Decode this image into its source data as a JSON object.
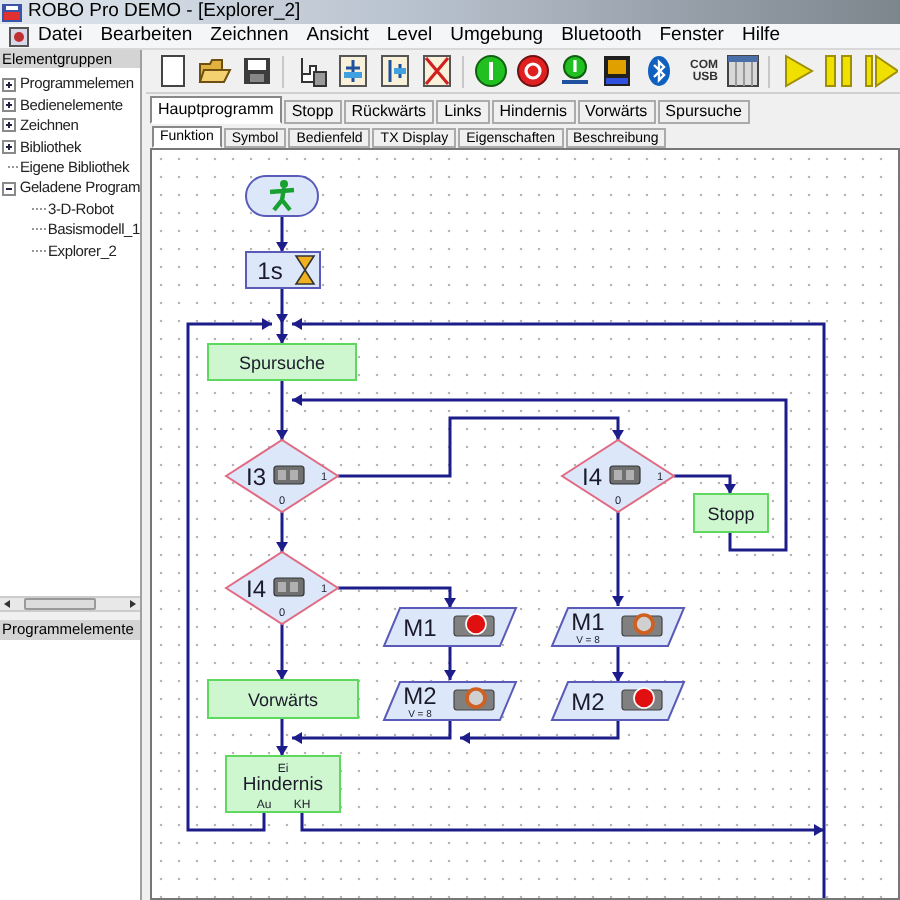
{
  "window": {
    "title": "ROBO Pro DEMO - [Explorer_2]"
  },
  "menu": [
    "Datei",
    "Bearbeiten",
    "Zeichnen",
    "Ansicht",
    "Level",
    "Umgebung",
    "Bluetooth",
    "Fenster",
    "Hilfe"
  ],
  "toolbar": {
    "com_label": "COM",
    "usb_label": "USB"
  },
  "sidebar": {
    "header": "Elementgruppen",
    "items": [
      {
        "label": "Programmelemen",
        "kind": "group",
        "expanded": false
      },
      {
        "label": "Bedienelemente",
        "kind": "group",
        "expanded": false
      },
      {
        "label": "Zeichnen",
        "kind": "group",
        "expanded": false
      },
      {
        "label": "Bibliothek",
        "kind": "group",
        "expanded": false
      },
      {
        "label": "Eigene Bibliothek",
        "kind": "leaf"
      },
      {
        "label": "Geladene Program",
        "kind": "group",
        "expanded": true,
        "children": [
          {
            "label": "3-D-Robot"
          },
          {
            "label": "Basismodell_1"
          },
          {
            "label": "Explorer_2"
          }
        ]
      }
    ],
    "lower_header": "Programmelemente"
  },
  "program_tabs": [
    {
      "label": "Hauptprogramm",
      "selected": true
    },
    {
      "label": "Stopp",
      "selected": false
    },
    {
      "label": "Rückwärts",
      "selected": false
    },
    {
      "label": "Links",
      "selected": false
    },
    {
      "label": "Hindernis",
      "selected": false
    },
    {
      "label": "Vorwärts",
      "selected": false
    },
    {
      "label": "Spursuche",
      "selected": false
    }
  ],
  "view_tabs": [
    {
      "label": "Funktion",
      "selected": true
    },
    {
      "label": "Symbol",
      "selected": false
    },
    {
      "label": "Bedienfeld",
      "selected": false
    },
    {
      "label": "TX Display",
      "selected": false
    },
    {
      "label": "Eigenschaften",
      "selected": false
    },
    {
      "label": "Beschreibung",
      "selected": false
    }
  ],
  "flowchart": {
    "nodes": [
      {
        "kind": "start"
      },
      {
        "kind": "wait",
        "label": "1s"
      },
      {
        "kind": "subprogram",
        "label": "Spursuche"
      },
      {
        "kind": "branch",
        "label": "I3",
        "true_port": "1",
        "false_port": "0"
      },
      {
        "kind": "branch",
        "label": "I4",
        "true_port": "1",
        "false_port": "0"
      },
      {
        "kind": "subprogram",
        "label": "Stopp"
      },
      {
        "kind": "branch",
        "label": "I4",
        "true_port": "1",
        "false_port": "0"
      },
      {
        "kind": "motor",
        "label": "M1",
        "running": false
      },
      {
        "kind": "motor",
        "label": "M1",
        "running": true,
        "speed": "V = 8"
      },
      {
        "kind": "subprogram",
        "label": "Vorwärts"
      },
      {
        "kind": "motor",
        "label": "M2",
        "running": true,
        "speed": "V = 8"
      },
      {
        "kind": "motor",
        "label": "M2",
        "running": false
      },
      {
        "kind": "subprogram",
        "label": "Hindernis",
        "input_port": "Ei",
        "output_ports": [
          "Au",
          "KH"
        ]
      }
    ]
  }
}
